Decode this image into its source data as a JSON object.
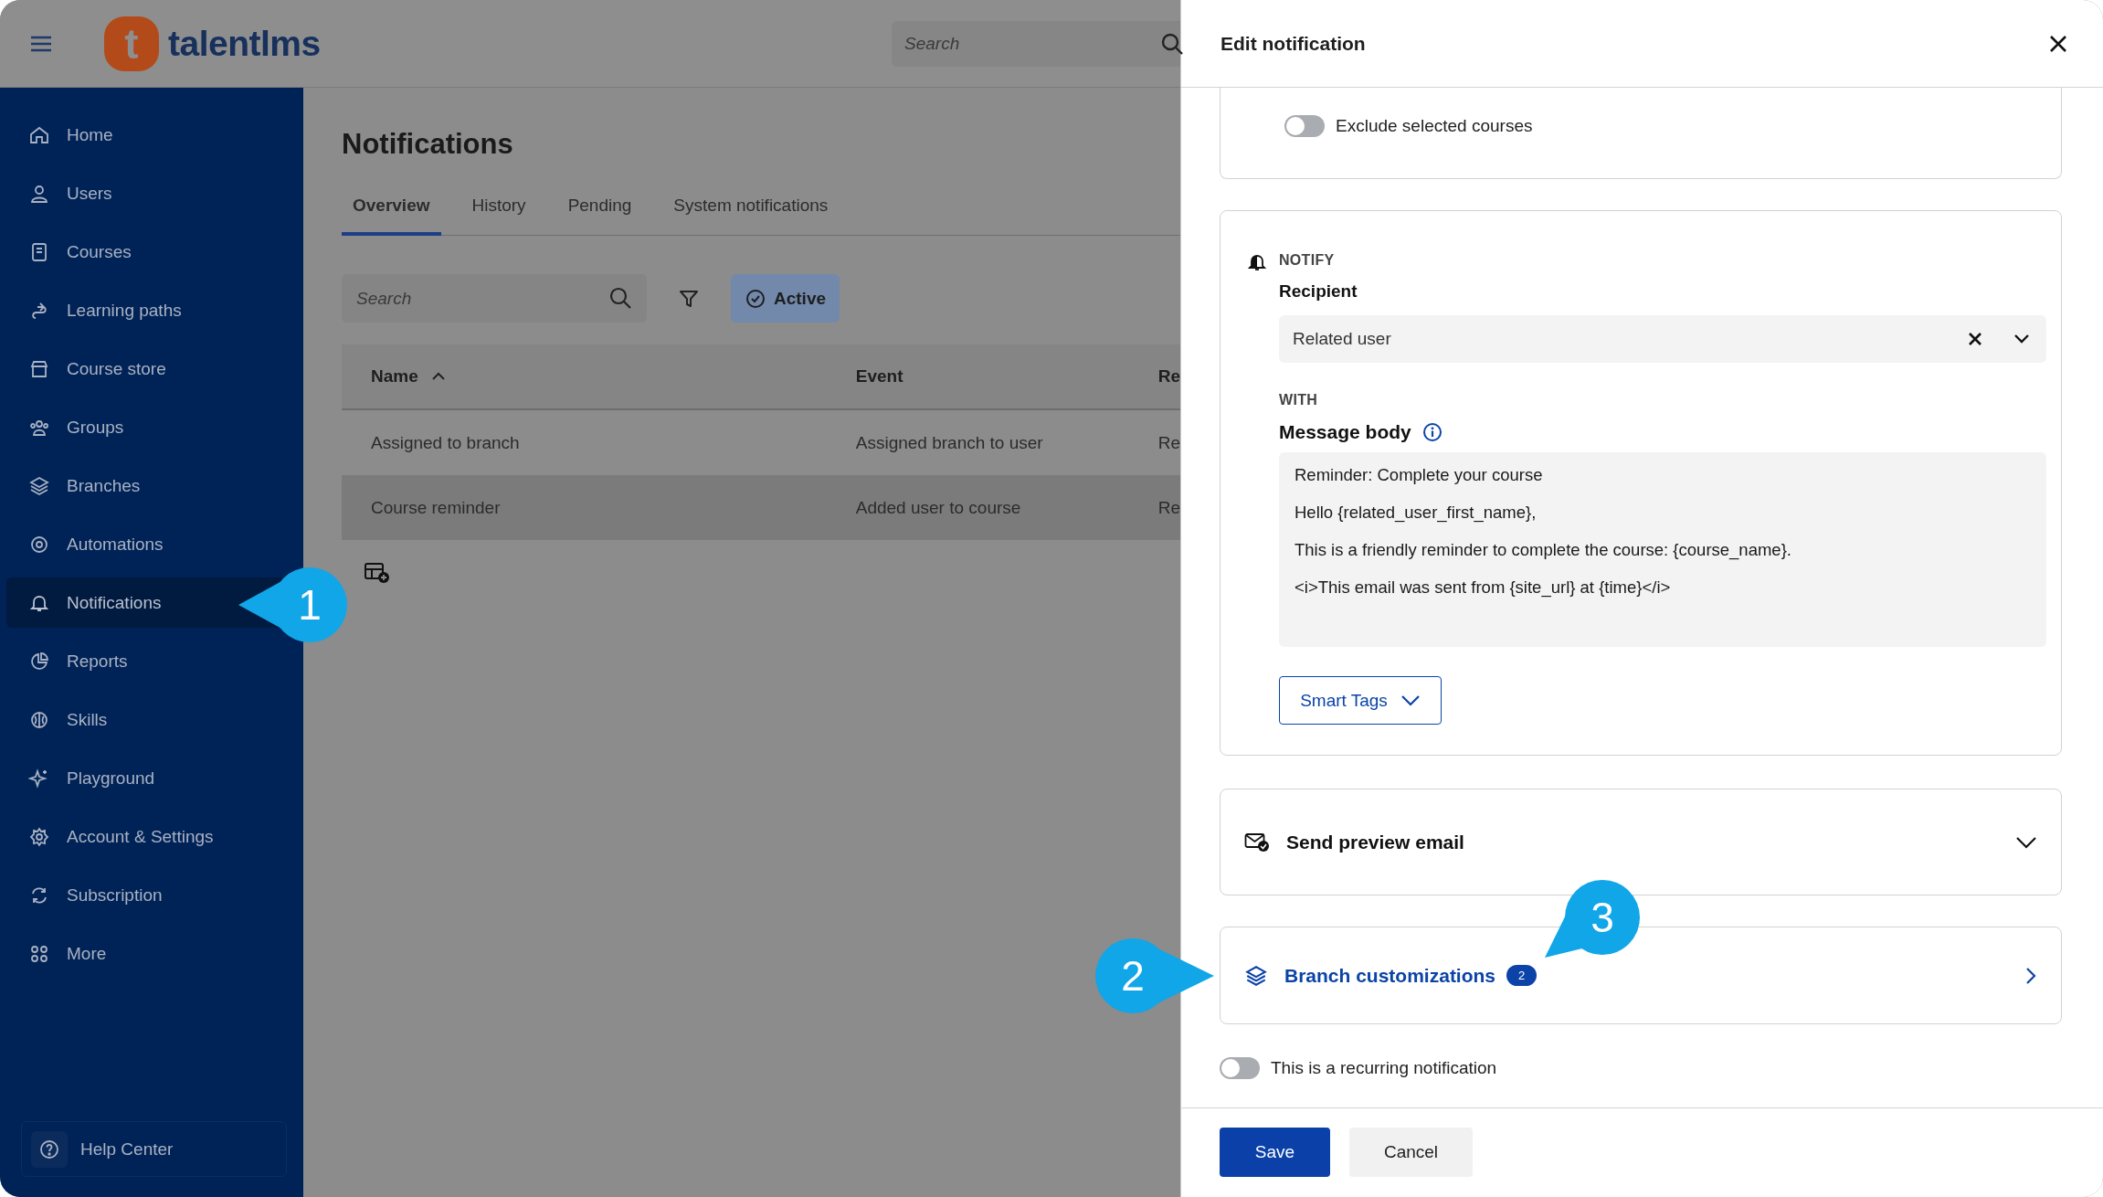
{
  "header": {
    "logo_mark": "t",
    "logo_text": "talentlms",
    "search": {
      "placeholder": "Search"
    }
  },
  "sidebar": {
    "items": [
      {
        "label": "Home",
        "selected": false
      },
      {
        "label": "Users",
        "selected": false
      },
      {
        "label": "Courses",
        "selected": false
      },
      {
        "label": "Learning paths",
        "selected": false
      },
      {
        "label": "Course store",
        "selected": false
      },
      {
        "label": "Groups",
        "selected": false
      },
      {
        "label": "Branches",
        "selected": false
      },
      {
        "label": "Automations",
        "selected": false
      },
      {
        "label": "Notifications",
        "selected": true
      },
      {
        "label": "Reports",
        "selected": false
      },
      {
        "label": "Skills",
        "selected": false
      },
      {
        "label": "Playground",
        "selected": false
      },
      {
        "label": "Account & Settings",
        "selected": false
      },
      {
        "label": "Subscription",
        "selected": false
      },
      {
        "label": "More",
        "selected": false
      }
    ],
    "help": "Help Center"
  },
  "page": {
    "title": "Notifications",
    "tabs": [
      {
        "label": "Overview",
        "selected": true
      },
      {
        "label": "History",
        "selected": false
      },
      {
        "label": "Pending",
        "selected": false
      },
      {
        "label": "System notifications",
        "selected": false
      }
    ],
    "search": {
      "placeholder": "Search"
    },
    "active_filter": "Active",
    "table": {
      "columns": [
        "Name",
        "Event",
        "Re"
      ],
      "rows": [
        {
          "cells": [
            "Assigned to branch",
            "Assigned branch to user",
            "Re"
          ],
          "selected": false
        },
        {
          "cells": [
            "Course reminder",
            "Added user to course",
            "Re"
          ],
          "selected": true
        }
      ]
    }
  },
  "drawer": {
    "title": "Edit notification",
    "exclude_toggle": {
      "label": "Exclude selected courses",
      "on": false
    },
    "notify": {
      "heading": "NOTIFY",
      "recipient_label": "Recipient",
      "recipient": "Related user",
      "with_heading": "WITH",
      "body_label": "Message body",
      "body_lines": [
        "Reminder: Complete your course",
        "Hello {related_user_first_name},",
        "This is a friendly reminder to complete the course: {course_name}.",
        "<i>This email was sent from {site_url} at {time}</i>"
      ],
      "smart_tags": "Smart Tags"
    },
    "preview": {
      "label": "Send preview email",
      "expanded": false
    },
    "branch": {
      "label": "Branch customizations",
      "count": "2"
    },
    "recurring": {
      "label": "This is a recurring notification",
      "on": false
    },
    "save": "Save",
    "cancel": "Cancel"
  },
  "callouts": [
    {
      "label": "1"
    },
    {
      "label": "2"
    },
    {
      "label": "3"
    }
  ]
}
